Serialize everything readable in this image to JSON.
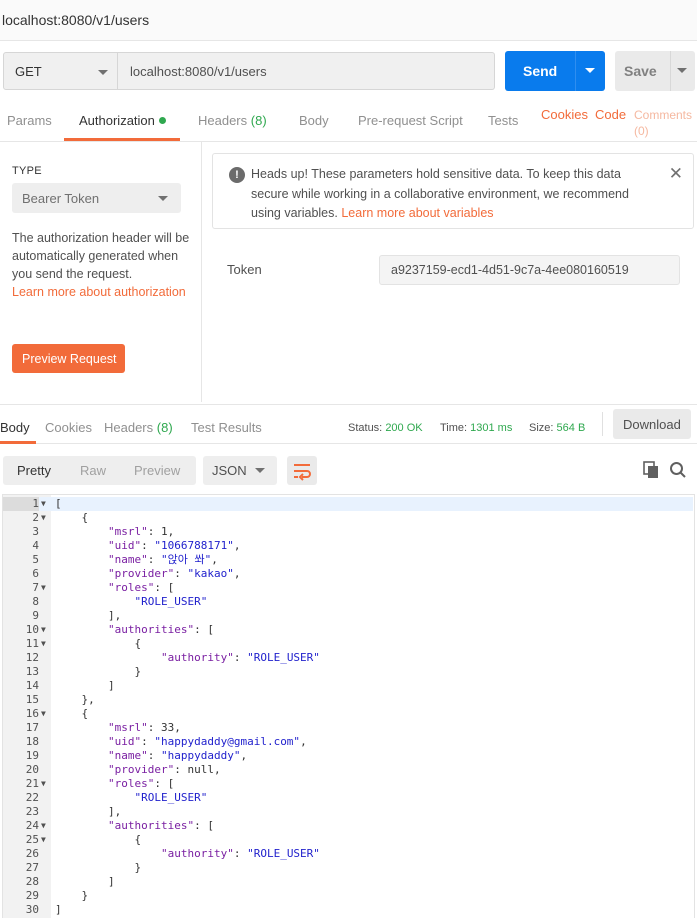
{
  "window": {
    "title": "localhost:8080/v1/users"
  },
  "request": {
    "method": "GET",
    "url": "localhost:8080/v1/users",
    "send_label": "Send",
    "save_label": "Save"
  },
  "request_tabs": {
    "params": "Params",
    "authorization": "Authorization",
    "headers": "Headers",
    "headers_count": "(8)",
    "body": "Body",
    "prerequest": "Pre-request Script",
    "tests": "Tests",
    "cookies": "Cookies",
    "code": "Code",
    "comments": "Comments",
    "comments_count": "(0)"
  },
  "auth": {
    "type_label": "TYPE",
    "type_value": "Bearer Token",
    "description": "The authorization header will be automatically generated when you send the request.",
    "learn_more": "Learn more about authorization",
    "preview_label": "Preview Request",
    "alert_text": "Heads up! These parameters hold sensitive data. To keep this data secure while working in a collaborative environment, we recommend using variables.",
    "alert_link": "Learn more about variables",
    "token_label": "Token",
    "token_value": "a9237159-ecd1-4d51-9c7a-4ee080160519"
  },
  "response": {
    "tabs": {
      "body": "Body",
      "cookies": "Cookies",
      "headers": "Headers",
      "headers_count": "(8)",
      "test_results": "Test Results"
    },
    "status_label": "Status:",
    "status_value": "200 OK",
    "time_label": "Time:",
    "time_value": "1301 ms",
    "size_label": "Size:",
    "size_value": "564 B",
    "download_label": "Download",
    "view_modes": [
      "Pretty",
      "Raw",
      "Preview"
    ],
    "active_view": "Pretty",
    "format": "JSON"
  },
  "icons": {
    "method_caret": "chevron-down-icon",
    "send_caret": "chevron-down-icon",
    "save_caret": "chevron-down-icon",
    "alert": "info-icon",
    "close": "close-icon",
    "wrap": "wrap-lines-icon",
    "copy": "copy-icon",
    "search": "search-icon"
  },
  "colors": {
    "accent": "#f26b3a",
    "send": "#097bed",
    "success": "#2fa84f"
  },
  "code_lines": [
    "[",
    "    {",
    "        \"msrl\": 1,",
    "        \"uid\": \"1066788171\",",
    "        \"name\": \"앉아 쏴\",",
    "        \"provider\": \"kakao\",",
    "        \"roles\": [",
    "            \"ROLE_USER\"",
    "        ],",
    "        \"authorities\": [",
    "            {",
    "                \"authority\": \"ROLE_USER\"",
    "            }",
    "        ]",
    "    },",
    "    {",
    "        \"msrl\": 33,",
    "        \"uid\": \"happydaddy@gmail.com\",",
    "        \"name\": \"happydaddy\",",
    "        \"provider\": null,",
    "        \"roles\": [",
    "            \"ROLE_USER\"",
    "        ],",
    "        \"authorities\": [",
    "            {",
    "                \"authority\": \"ROLE_USER\"",
    "            }",
    "        ]",
    "    }",
    "]"
  ],
  "foldable_lines": [
    1,
    2,
    7,
    10,
    11,
    16,
    21,
    24,
    25
  ]
}
